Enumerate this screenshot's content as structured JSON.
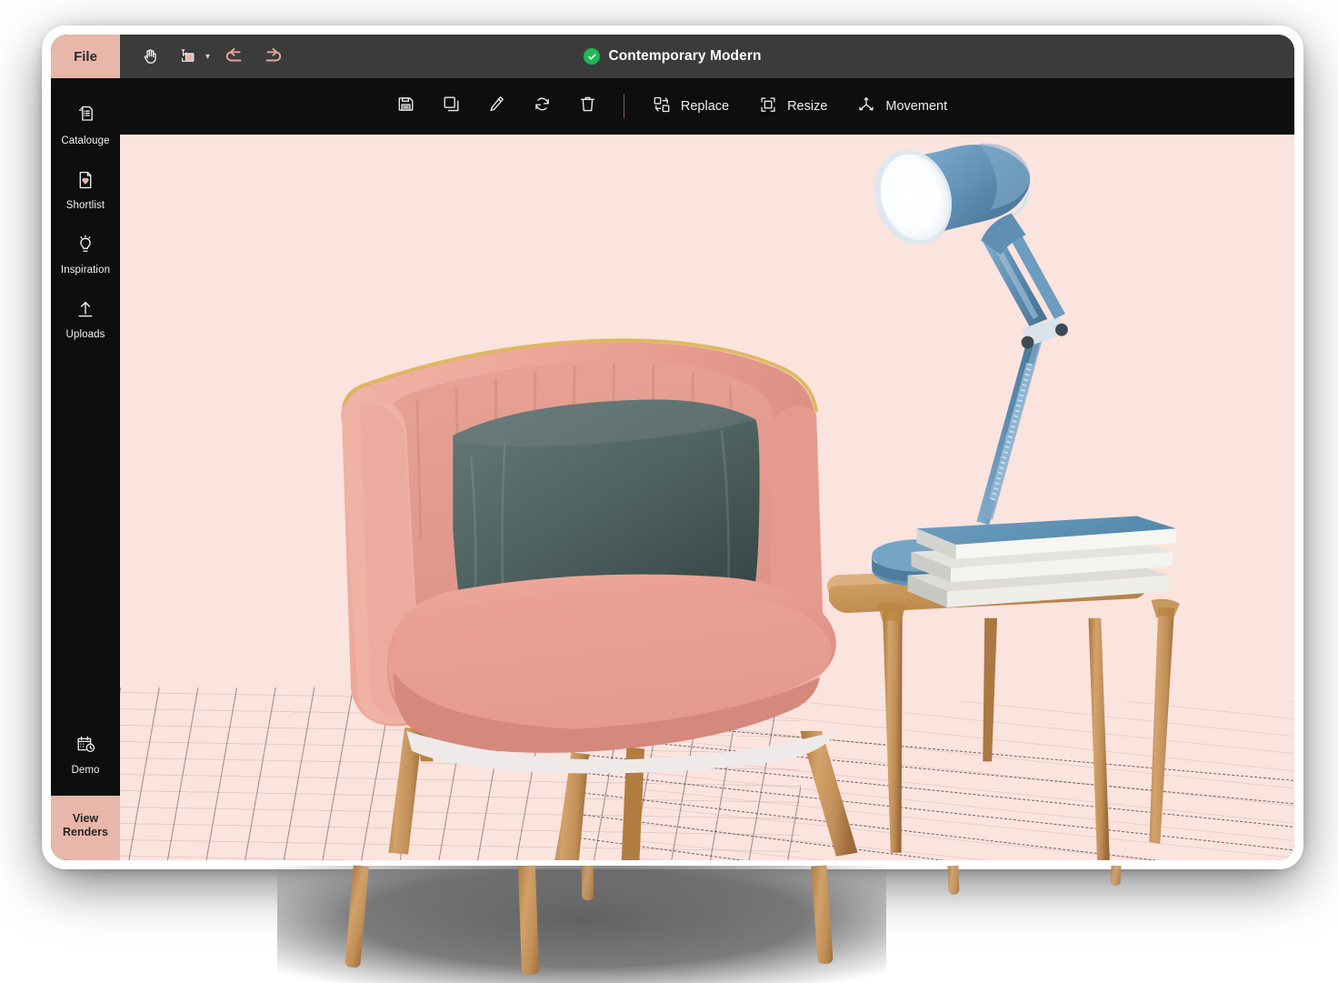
{
  "window": {
    "titlebar": {
      "file_label": "File",
      "tools": [
        {
          "name": "hand-tool-icon",
          "label": "Hand"
        },
        {
          "name": "color-swatch-tool-icon",
          "label": "Color"
        },
        {
          "name": "undo-icon",
          "label": "Undo"
        },
        {
          "name": "redo-icon",
          "label": "Redo"
        }
      ],
      "project_title": "Contemporary Modern",
      "status": "saved"
    },
    "actionbar": {
      "icons": [
        {
          "name": "save-icon",
          "label": "Save"
        },
        {
          "name": "duplicate-icon",
          "label": "Duplicate"
        },
        {
          "name": "edit-pencil-icon",
          "label": "Edit"
        },
        {
          "name": "rotate-refresh-icon",
          "label": "Rotate"
        },
        {
          "name": "delete-trash-icon",
          "label": "Delete"
        }
      ],
      "actions": [
        {
          "name": "replace-action",
          "label": "Replace",
          "icon": "replace-icon"
        },
        {
          "name": "resize-action",
          "label": "Resize",
          "icon": "resize-icon"
        },
        {
          "name": "movement-action",
          "label": "Movement",
          "icon": "movement-axes-icon"
        }
      ]
    },
    "sidebar": {
      "items": [
        {
          "label": "Catalouge",
          "icon": "catalogue-stack-icon"
        },
        {
          "label": "Shortlist",
          "icon": "heart-page-icon"
        },
        {
          "label": "Inspiration",
          "icon": "lightbulb-icon"
        },
        {
          "label": "Uploads",
          "icon": "upload-arrow-icon"
        }
      ],
      "demo": {
        "label": "Demo",
        "icon": "calendar-clock-icon"
      },
      "view_renders": {
        "label": "View\nRenders",
        "line1": "View",
        "line2": "Renders"
      }
    },
    "canvas": {
      "background_color": "#fbe3de",
      "scene_objects": [
        {
          "name": "pink-velvet-armchair",
          "color": "#e8a89c"
        },
        {
          "name": "teal-throw-cushion",
          "color": "#4d5d5c"
        },
        {
          "name": "blue-desk-lamp",
          "color": "#6b9dc2"
        },
        {
          "name": "wooden-side-table",
          "color": "#c49055"
        },
        {
          "name": "book-stack",
          "color": "#efefec"
        },
        {
          "name": "floor-rug-shadow",
          "color": "#6e6e6e"
        }
      ]
    }
  },
  "colors": {
    "accent_salmon": "#e9b7a9",
    "titlebar": "#3b3b3b",
    "toolbar": "#0e0e0e",
    "canvas_pink": "#fbe3de",
    "status_green": "#1eb855"
  }
}
